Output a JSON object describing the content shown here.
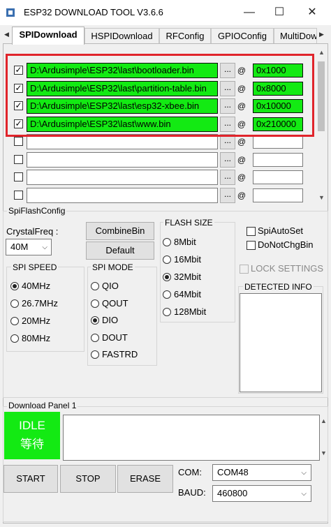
{
  "window": {
    "title": "ESP32 DOWNLOAD TOOL V3.6.6",
    "minimize": "—",
    "maximize": "☐",
    "close": "✕"
  },
  "tabs": [
    {
      "label": "SPIDownload"
    },
    {
      "label": "HSPIDownload"
    },
    {
      "label": "RFConfig"
    },
    {
      "label": "GPIOConfig"
    },
    {
      "label": "MultiDow"
    }
  ],
  "files": [
    {
      "checked": true,
      "path": "D:\\Ardusimple\\ESP32\\last\\bootloader.bin",
      "address": "0x1000",
      "dots": "...",
      "at": "@"
    },
    {
      "checked": true,
      "path": "D:\\Ardusimple\\ESP32\\last\\partition-table.bin",
      "address": "0x8000",
      "dots": "...",
      "at": "@"
    },
    {
      "checked": true,
      "path": "D:\\Ardusimple\\ESP32\\last\\esp32-xbee.bin",
      "address": "0x10000",
      "dots": "...",
      "at": "@"
    },
    {
      "checked": true,
      "path": "D:\\Ardusimple\\ESP32\\last\\www.bin",
      "address": "0x210000",
      "dots": "...",
      "at": "@"
    },
    {
      "checked": false,
      "path": "",
      "address": "",
      "dots": "...",
      "at": "@"
    },
    {
      "checked": false,
      "path": "",
      "address": "",
      "dots": "...",
      "at": "@"
    },
    {
      "checked": false,
      "path": "",
      "address": "",
      "dots": "...",
      "at": "@"
    },
    {
      "checked": false,
      "path": "",
      "address": "",
      "dots": "...",
      "at": "@"
    }
  ],
  "spi_flash_config": {
    "title": "SpiFlashConfig",
    "crystal_label": "CrystalFreq :",
    "crystal_value": "40M",
    "combine_button": "CombineBin",
    "default_button": "Default",
    "spi_speed": {
      "title": "SPI SPEED",
      "options": [
        "40MHz",
        "26.7MHz",
        "20MHz",
        "80MHz"
      ],
      "selected": "40MHz"
    },
    "spi_mode": {
      "title": "SPI MODE",
      "options": [
        "QIO",
        "QOUT",
        "DIO",
        "DOUT",
        "FASTRD"
      ],
      "selected": "DIO"
    },
    "flash_size": {
      "title": "FLASH SIZE",
      "options": [
        "8Mbit",
        "16Mbit",
        "32Mbit",
        "64Mbit",
        "128Mbit"
      ],
      "selected": "32Mbit"
    },
    "spi_auto_set": "SpiAutoSet",
    "do_not_chg_bin": "DoNotChgBin",
    "lock_settings": "LOCK SETTINGS",
    "detected_info": "DETECTED INFO"
  },
  "download_panel": {
    "title": "Download Panel 1",
    "status_line1": "IDLE",
    "status_line2": "等待",
    "status_color": "#13ea13",
    "start_button": "START",
    "stop_button": "STOP",
    "erase_button": "ERASE",
    "com_label": "COM:",
    "com_value": "COM48",
    "baud_label": "BAUD:",
    "baud_value": "460800"
  }
}
